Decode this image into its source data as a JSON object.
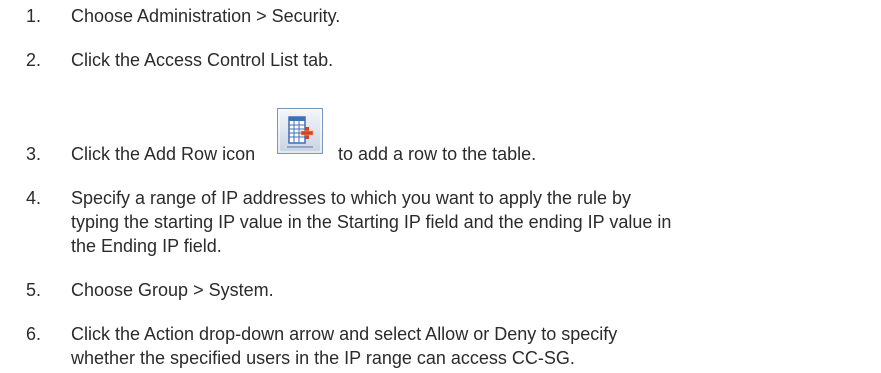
{
  "steps": [
    {
      "number": "1.",
      "lines": [
        "Choose Administration > Security."
      ]
    },
    {
      "number": "2.",
      "lines": [
        "Click the Access Control List tab."
      ]
    },
    {
      "number": "3.",
      "before_icon": "Click the Add Row icon",
      "icon": "add-row-icon",
      "after_icon": "to add a row to the table."
    },
    {
      "number": "4.",
      "lines": [
        "Specify a range of IP addresses to which you want to apply the rule by",
        "typing the starting IP value in the Starting IP field and the ending IP value in",
        "the Ending IP field."
      ]
    },
    {
      "number": "5.",
      "lines": [
        "Choose Group > System."
      ]
    },
    {
      "number": "6.",
      "lines": [
        "Click the Action drop-down arrow and select Allow or Deny to specify",
        "whether the specified users in the IP range can access CC-SG."
      ]
    }
  ],
  "colors": {
    "text": "#2b2b2b",
    "icon_frame": "#7a96c2",
    "icon_grid": "#3f6fb5",
    "icon_plus": "#d9402b"
  }
}
